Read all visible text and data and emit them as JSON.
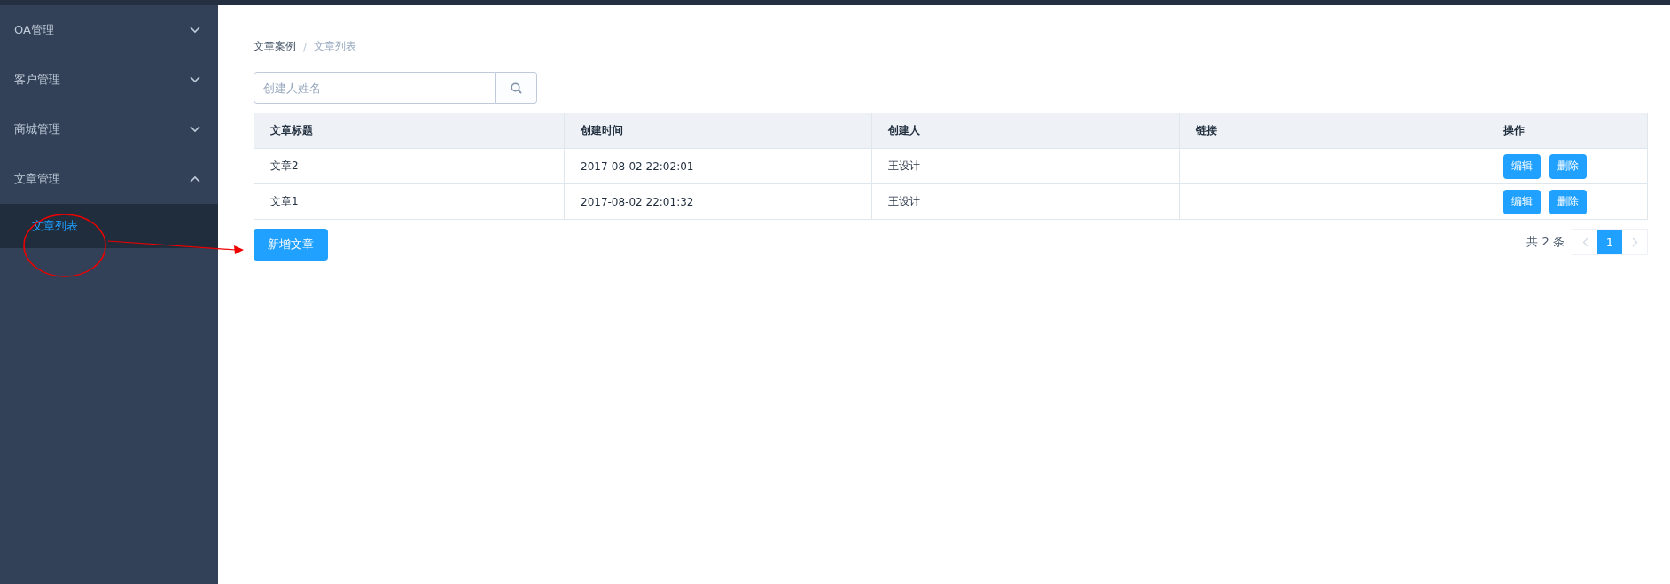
{
  "sidebar": {
    "menus": [
      {
        "label": "OA管理",
        "expanded": false
      },
      {
        "label": "客户管理",
        "expanded": false
      },
      {
        "label": "商城管理",
        "expanded": false
      },
      {
        "label": "文章管理",
        "expanded": true,
        "children": [
          {
            "label": "文章列表",
            "selected": true
          }
        ]
      }
    ]
  },
  "breadcrumb": [
    "文章案例",
    "文章列表"
  ],
  "breadcrumb_separator": "/",
  "search": {
    "placeholder": "创建人姓名"
  },
  "table": {
    "columns": [
      "文章标题",
      "创建时间",
      "创建人",
      "链接",
      "操作"
    ],
    "rows": [
      {
        "cells": [
          "文章2",
          "2017-08-02 22:02:01",
          "王设计",
          ""
        ],
        "actions": [
          "编辑",
          "删除"
        ]
      },
      {
        "cells": [
          "文章1",
          "2017-08-02 22:01:32",
          "王设计",
          ""
        ],
        "actions": [
          "编辑",
          "删除"
        ]
      }
    ]
  },
  "add_button": "新增文章",
  "pagination": {
    "total": "共 2 条",
    "pages": [
      {
        "label": "1",
        "selected": true
      }
    ]
  }
}
